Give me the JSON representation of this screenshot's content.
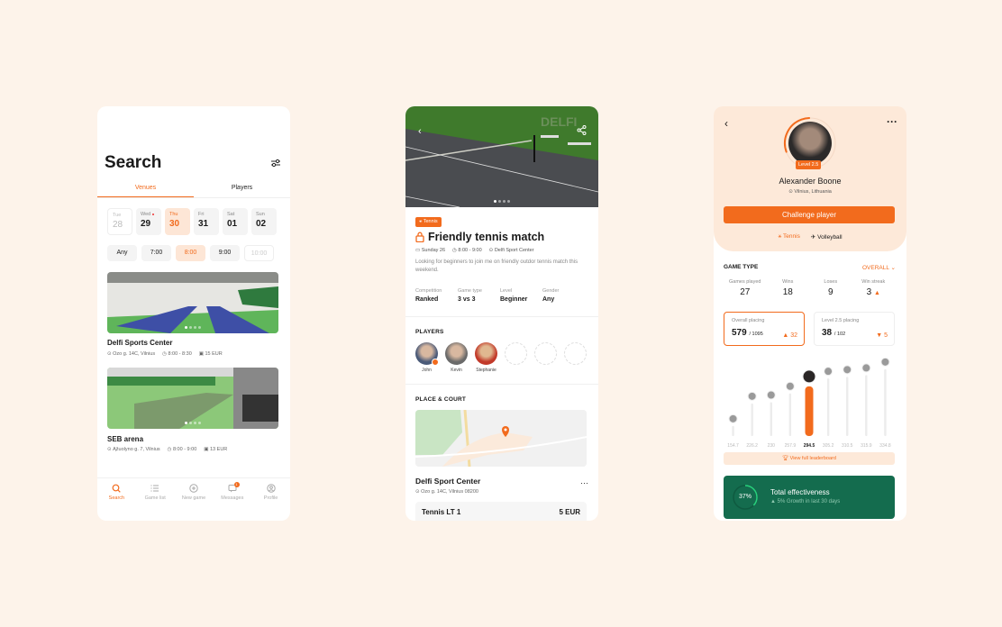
{
  "colors": {
    "accent": "#f26b1d",
    "accent_light": "#fde9d9",
    "effectiveness_bg": "#146c4e",
    "page_bg": "#fdf3ea"
  },
  "search_screen": {
    "title": "Search",
    "filter_icon": "sliders-icon",
    "tabs": [
      {
        "label": "Venues",
        "active": true
      },
      {
        "label": "Players",
        "active": false
      }
    ],
    "days": [
      {
        "name": "Tue",
        "date": "28",
        "state": "past"
      },
      {
        "name": "Wed",
        "date": "29",
        "state": "dot"
      },
      {
        "name": "Thu",
        "date": "30",
        "state": "selected"
      },
      {
        "name": "Fri",
        "date": "31",
        "state": "normal"
      },
      {
        "name": "Sat",
        "date": "01",
        "state": "normal"
      },
      {
        "name": "Sun",
        "date": "02",
        "state": "normal"
      }
    ],
    "times": [
      {
        "label": "Any",
        "state": "normal"
      },
      {
        "label": "7:00",
        "state": "normal"
      },
      {
        "label": "8:00",
        "state": "selected"
      },
      {
        "label": "9:00",
        "state": "normal"
      },
      {
        "label": "10:00",
        "state": "disabled"
      }
    ],
    "venues": [
      {
        "name": "Delfi Sports Center",
        "address": "Ozo g. 14C, Vilnius",
        "time": "8:00 - 8:30",
        "price": "15 EUR"
      },
      {
        "name": "SEB arena",
        "address": "Ąžuolyno g. 7, Vilnius",
        "time": "8:00 - 9:00",
        "price": "13 EUR"
      }
    ],
    "nav": [
      {
        "label": "Search",
        "icon": "search-icon",
        "active": true
      },
      {
        "label": "Game list",
        "icon": "list-icon",
        "active": false
      },
      {
        "label": "New game",
        "icon": "plus-circle-icon",
        "active": false
      },
      {
        "label": "Messages",
        "icon": "chat-icon",
        "active": false,
        "badge": "1"
      },
      {
        "label": "Profile",
        "icon": "user-icon",
        "active": false
      }
    ]
  },
  "match_screen": {
    "tag": "Tennis",
    "title": "Friendly tennis match",
    "date": "Sunday 26",
    "time": "8:00 - 9:00",
    "venue": "Delfi Sport Center",
    "description": "Looking for beginners to join me on friendly outdor tennis match this weekend.",
    "attributes": [
      {
        "label": "Competition",
        "value": "Ranked"
      },
      {
        "label": "Game type",
        "value": "3 vs 3"
      },
      {
        "label": "Level",
        "value": "Beginner"
      },
      {
        "label": "Gender",
        "value": "Any"
      }
    ],
    "players_title": "PLAYERS",
    "players": [
      "John",
      "Kevin",
      "Stephanie"
    ],
    "empty_slots": 3,
    "place_title": "PLACE & COURT",
    "court_venue": "Delfi Sport Center",
    "court_address": "Ozo g. 14C, Vilnius 08200",
    "court": {
      "name": "Tennis LT 1",
      "price": "5 EUR"
    }
  },
  "profile_screen": {
    "name": "Alexander Boone",
    "location": "Vilnius, Lithuania",
    "level": "Level 2.5",
    "level_progress": 0.3,
    "challenge_label": "Challenge player",
    "sports": [
      {
        "label": "Tennis",
        "active": true
      },
      {
        "label": "Volleyball",
        "active": false
      }
    ],
    "game_type_label": "GAME TYPE",
    "filter_label": "OVERALL",
    "stats": [
      {
        "label": "Games played",
        "value": "27"
      },
      {
        "label": "Wins",
        "value": "18"
      },
      {
        "label": "Loses",
        "value": "9"
      },
      {
        "label": "Win streak",
        "value": "3"
      }
    ],
    "placings": [
      {
        "label": "Overall placing",
        "value": "579",
        "total": "/ 1095",
        "delta": "32",
        "direction": "up"
      },
      {
        "label": "Level 2.5 placing",
        "value": "38",
        "total": "/ 102",
        "delta": "5",
        "direction": "down"
      }
    ],
    "leaderboard": {
      "scores": [
        154.7,
        226.2,
        230,
        257.9,
        294.5,
        305.2,
        310.5,
        315.9,
        334.8
      ],
      "labels": [
        "154.7",
        "226.2",
        "230",
        "257.9",
        "294.5",
        "305.2",
        "310.5",
        "315.9",
        "334.8"
      ],
      "highlight_index": 4
    },
    "leaderboard_button": "View full leaderboard",
    "effectiveness": {
      "percent": 37,
      "label": "37%",
      "title": "Total effectiveness",
      "subtitle": "5% Growth in last 30 days"
    }
  }
}
